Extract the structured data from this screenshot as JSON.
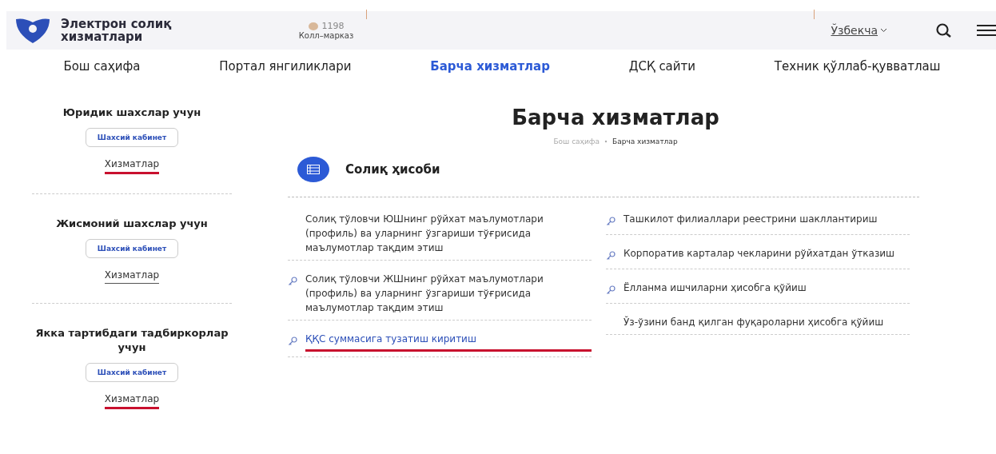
{
  "header": {
    "brand": "Электрон солиқ хизматлари",
    "phone": "1198",
    "phone_label": "Колл–марказ",
    "language": "Ўзбекча"
  },
  "nav": [
    {
      "label": "Бош саҳифа",
      "selected": false
    },
    {
      "label": "Портал янгиликлари",
      "selected": false
    },
    {
      "label": "Барча хизматлар",
      "selected": true
    },
    {
      "label": "ДСҚ сайти",
      "selected": false
    },
    {
      "label": "Техник қўллаб-қувватлаш",
      "selected": false
    }
  ],
  "sidebar": [
    {
      "title": "Юридик шахслар учун",
      "button": "Шахсий кабинет",
      "link": "Хизматлар",
      "marked": true
    },
    {
      "title": "Жисмоний шахслар учун",
      "button": "Шахсий кабинет",
      "link": "Хизматлар",
      "marked": false
    },
    {
      "title": "Якка тартибдаги тадбиркорлар учун",
      "button": "Шахсий кабинет",
      "link": "Хизматлар",
      "marked": true
    }
  ],
  "page_title": "Барча хизматлар",
  "breadcrumbs": [
    "Бош саҳифа",
    "Барча хизматлар"
  ],
  "section": {
    "title": "Солиқ ҳисоби",
    "columns": [
      [
        {
          "text": "Солиқ тўловчи ЮШнинг рўйхат маълумотлари (профиль) ва уларнинг ўзгариши тўғрисида маълумотлар тақдим этиш",
          "key_icon": false,
          "marked": false
        },
        {
          "text": "Солиқ тўловчи ЖШнинг рўйхат маълумотлари (профиль) ва уларнинг ўзгариши тўғрисида маълумотлар тақдим этиш",
          "key_icon": true,
          "marked": false
        },
        {
          "text": "ҚҚС суммасига тузатиш киритиш",
          "key_icon": true,
          "marked": true
        }
      ],
      [
        {
          "text": "Ташкилот филиаллари реестрини шакллантириш",
          "key_icon": true,
          "marked": false
        },
        {
          "text": "Корпоратив карталар чекларини рўйхатдан ўтказиш",
          "key_icon": true,
          "marked": false
        },
        {
          "text": "Ёлланма ишчиларни ҳисобга қўйиш",
          "key_icon": true,
          "marked": false
        },
        {
          "text": "Ўз-ўзини банд қилган фуқароларни ҳисобга қўйиш",
          "key_icon": false,
          "marked": false
        }
      ]
    ]
  }
}
